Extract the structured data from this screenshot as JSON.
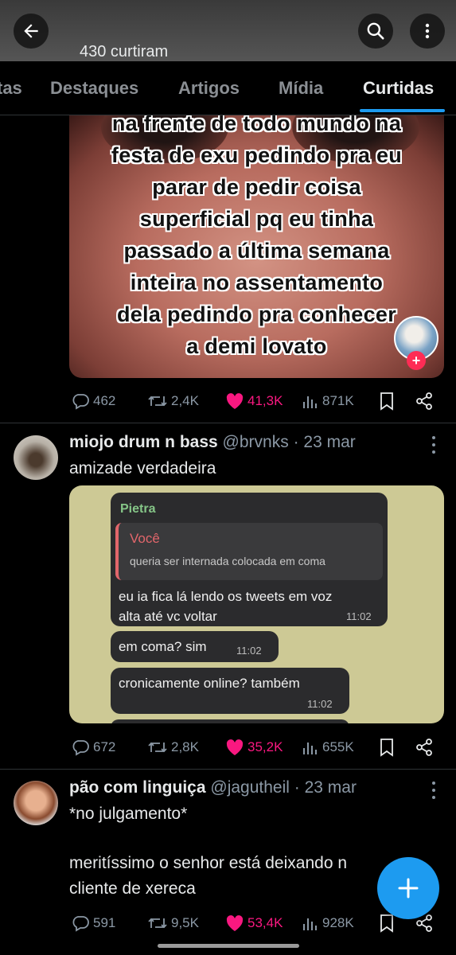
{
  "header": {
    "likes_count": "430 curtiram",
    "back_icon": "arrow-left-icon",
    "search_icon": "search-icon",
    "more_icon": "more-vertical-icon"
  },
  "tabs": [
    {
      "label": "tas"
    },
    {
      "label": "Destaques"
    },
    {
      "label": "Artigos"
    },
    {
      "label": "Mídia"
    },
    {
      "label": "Curtidas",
      "active": true
    }
  ],
  "tweets": [
    {
      "media_overlay_lines": [
        "na frente de todo mundo na",
        "festa de exu pedindo pra eu",
        "parar de pedir coisa",
        "superficial pq eu tinha",
        "passado a última semana",
        "inteira no assentamento",
        "dela pedindo pra conhecer",
        "a demi lovato"
      ],
      "actions": {
        "replies": "462",
        "retweets": "2,4K",
        "likes": "41,3K",
        "views": "871K"
      }
    },
    {
      "name": "miojo drum n bass",
      "handle": "@brvnks",
      "date": "· 23 mar",
      "text": "amizade verdadeira",
      "chat": {
        "sender": "Pietra",
        "reply_name": "Você",
        "reply_text": "queria ser internada colocada em coma",
        "msg1_line1": "eu ia fica lá lendo os tweets em voz",
        "msg1_line2": "alta até vc voltar",
        "msg1_time": "11:02",
        "msg2": "em coma? sim",
        "msg2_time": "11:02",
        "msg3": "cronicamente online? também",
        "msg3_time": "11:02"
      },
      "actions": {
        "replies": "672",
        "retweets": "2,8K",
        "likes": "35,2K",
        "views": "655K"
      }
    },
    {
      "name": "pão com linguiça",
      "handle": "@jagutheil",
      "date": "· 23 mar",
      "text_line1": "*no julgamento*",
      "text_line2": "meritíssimo o senhor está deixando n",
      "text_line3": "cliente de xereca",
      "actions": {
        "replies": "591",
        "retweets": "9,5K",
        "likes": "53,4K",
        "views": "928K"
      }
    }
  ],
  "colors": {
    "accent": "#1d9bf0",
    "like": "#f91880",
    "muted": "#8b98a5"
  }
}
